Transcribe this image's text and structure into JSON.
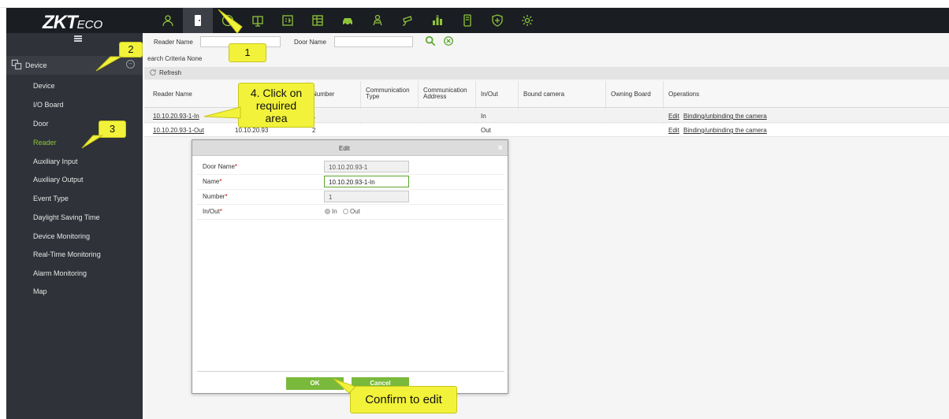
{
  "app": {
    "logo_main": "ZKT",
    "logo_sub": "ECO"
  },
  "topnav": [
    {
      "name": "personnel-icon",
      "label": ""
    },
    {
      "name": "access-door-icon",
      "label": ""
    },
    {
      "name": "attendance-clock-icon",
      "label": ""
    },
    {
      "name": "elevator-icon",
      "label": ""
    },
    {
      "name": "visitor-icon",
      "label": ""
    },
    {
      "name": "building-grid-icon",
      "label": ""
    },
    {
      "name": "parking-car-icon",
      "label": ""
    },
    {
      "name": "patrol-icon",
      "label": ""
    },
    {
      "name": "video-camera-icon",
      "label": ""
    },
    {
      "name": "consumption-icon",
      "label": ""
    },
    {
      "name": "intercom-icon",
      "label": ""
    },
    {
      "name": "shield-icon",
      "label": ""
    },
    {
      "name": "settings-gear-icon",
      "label": ""
    }
  ],
  "sidebar": {
    "module": "Device",
    "items": [
      "Device",
      "I/O Board",
      "Door",
      "Reader",
      "Auxiliary Input",
      "Auxiliary Output",
      "Event Type",
      "Daylight Saving Time",
      "Device Monitoring",
      "Real-Time Monitoring",
      "Alarm Monitoring",
      "Map"
    ],
    "active_item": "Reader"
  },
  "search": {
    "reader_name_label": "Reader Name",
    "reader_name_value": "",
    "door_name_label": "Door Name",
    "door_name_value": "",
    "criteria": "earch Criteria  None"
  },
  "toolbar": {
    "refresh": "Refresh"
  },
  "table": {
    "columns": [
      "Reader Name",
      "Number",
      "Communication Type",
      "Communication Address",
      "In/Out",
      "Bound camera",
      "Owning Board",
      "Operations"
    ],
    "rows": [
      {
        "reader_name": "10.10.20.93-1-In",
        "door": "",
        "number": "1",
        "comm_type": "",
        "comm_address": "",
        "in_out": "In",
        "camera": "",
        "board": "",
        "op_edit": "Edit",
        "op_bind": "Binding/unbinding the camera"
      },
      {
        "reader_name": "10.10.20.93-1-Out",
        "door": "10.10.20.93",
        "number": "2",
        "comm_type": "",
        "comm_address": "",
        "in_out": "Out",
        "camera": "",
        "board": "",
        "op_edit": "Edit",
        "op_bind": "Binding/unbinding the camera"
      }
    ]
  },
  "dialog": {
    "title": "Edit",
    "close": "×",
    "fields": {
      "door_name_label": "Door Name",
      "door_name_value": "10.10.20.93-1",
      "name_label": "Name",
      "name_value": "10.10.20.93-1-In",
      "number_label": "Number",
      "number_value": "1",
      "inout_label": "In/Out",
      "opt_in": "In",
      "opt_out": "Out",
      "selected": "In"
    },
    "ok": "OK",
    "cancel": "Cancel"
  },
  "callouts": {
    "c1": "1",
    "c2": "2",
    "c3": "3",
    "c4": "4. Click on required area",
    "c5": "Confirm to edit"
  },
  "colors": {
    "accent": "#8fc43a",
    "button": "#79b93b",
    "callout": "#f2f23a",
    "sidebar": "#2f3238"
  }
}
